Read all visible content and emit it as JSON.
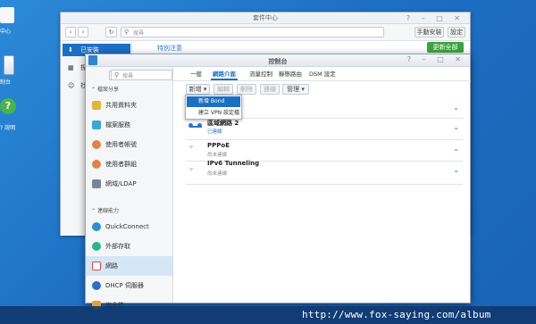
{
  "desktop": {
    "icons": [
      {
        "label": "中心"
      },
      {
        "label": "制台"
      },
      {
        "label": "? 說明"
      }
    ],
    "watermark": "http://www.fox-saying.com/album"
  },
  "package_center": {
    "title": "套件中心",
    "search_placeholder": "搜尋",
    "manual_install": "手動安裝",
    "settings": "設定",
    "sidebar_items": [
      "已安裝",
      "探索",
      "社群"
    ],
    "tab": "特別注意",
    "update_all": "更新全部"
  },
  "control_panel": {
    "title": "控制台",
    "search_placeholder": "搜尋",
    "sections": [
      {
        "label": "檔案分享"
      },
      {
        "label": "連線能力"
      }
    ],
    "nav_items": [
      {
        "label": "共用資料夾",
        "color": "#e2b43a"
      },
      {
        "label": "檔案服務",
        "color": "#3aa7d4"
      },
      {
        "label": "使用者帳號",
        "color": "#e08446"
      },
      {
        "label": "使用者群組",
        "color": "#e08446"
      },
      {
        "label": "網域/LDAP",
        "color": "#7a8591"
      },
      {
        "label": "QuickConnect",
        "color": "#2e8fd1"
      },
      {
        "label": "外部存取",
        "color": "#2db38c"
      },
      {
        "label": "網路",
        "color": "#d9483b"
      },
      {
        "label": "DHCP 伺服器",
        "color": "#2d6fc0"
      },
      {
        "label": "安全性",
        "color": "#e3a52f"
      }
    ],
    "tabs": [
      "一般",
      "網路介面",
      "流量控制",
      "靜態路由",
      "DSM 設定"
    ],
    "buttons": {
      "create": "新增 ▾",
      "edit": "編輯",
      "delete": "刪除",
      "connect": "連線",
      "manage": "管理 ▾"
    },
    "dropdown": [
      "新增 Bond",
      "建立 VPN 設定檔"
    ],
    "interfaces": [
      {
        "name": "區域網路 2",
        "status": "已連線",
        "status_color": "#2a78c8"
      },
      {
        "name": "PPPoE",
        "status": "尚未連線",
        "status_color": "#888"
      },
      {
        "name": "IPv6 Tunneling",
        "status": "尚未連線",
        "status_color": "#888"
      }
    ]
  }
}
